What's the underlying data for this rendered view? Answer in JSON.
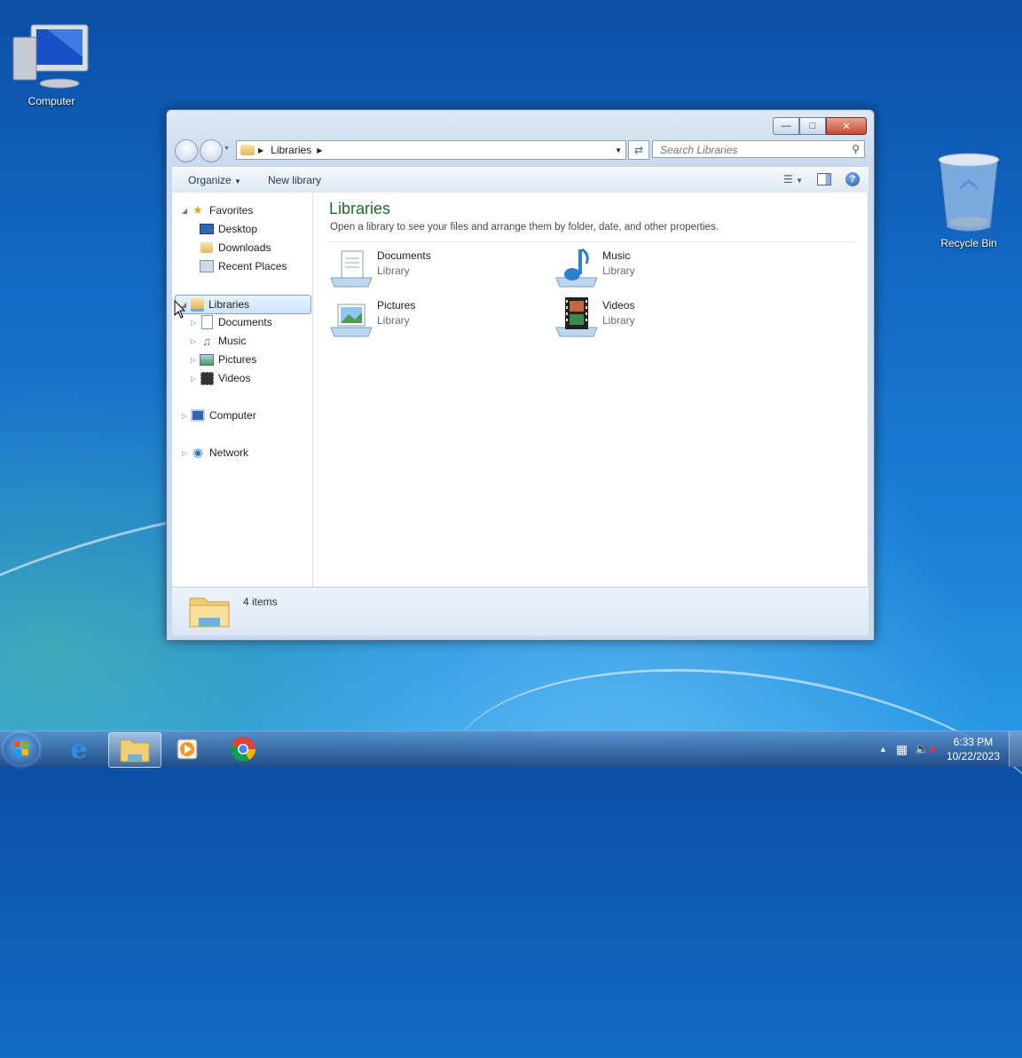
{
  "desktop": {
    "icons": [
      {
        "label": "Computer"
      },
      {
        "label": "Recycle Bin"
      }
    ]
  },
  "window": {
    "address": {
      "crumb": "Libraries"
    },
    "search": {
      "placeholder": "Search Libraries"
    },
    "toolbar": {
      "organize": "Organize",
      "new_library": "New library"
    },
    "nav": {
      "favorites": "Favorites",
      "favorites_items": [
        "Desktop",
        "Downloads",
        "Recent Places"
      ],
      "libraries": "Libraries",
      "libraries_items": [
        "Documents",
        "Music",
        "Pictures",
        "Videos"
      ],
      "computer": "Computer",
      "network": "Network"
    },
    "content": {
      "title": "Libraries",
      "subtitle": "Open a library to see your files and arrange them by folder, date, and other properties.",
      "items": [
        {
          "name": "Documents",
          "kind": "Library"
        },
        {
          "name": "Music",
          "kind": "Library"
        },
        {
          "name": "Pictures",
          "kind": "Library"
        },
        {
          "name": "Videos",
          "kind": "Library"
        }
      ]
    },
    "details": {
      "count": "4 items"
    }
  },
  "taskbar": {
    "clock": {
      "time": "6:33 PM",
      "date": "10/22/2023"
    }
  }
}
